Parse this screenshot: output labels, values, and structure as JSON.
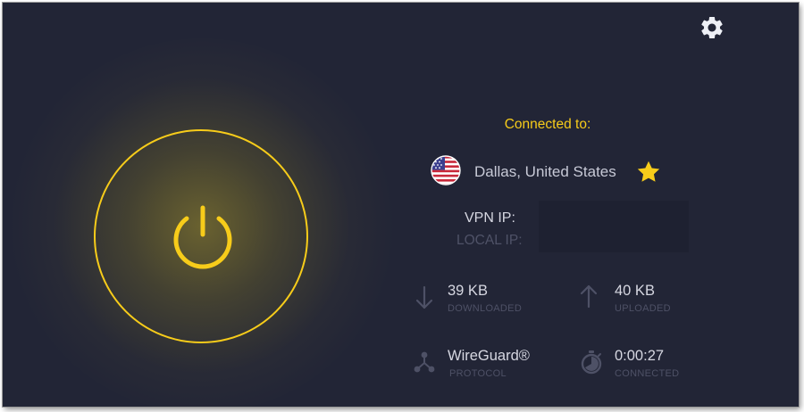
{
  "header": {
    "settings_icon": "gear-icon"
  },
  "power": {
    "state": "connected",
    "icon": "power-icon",
    "color": "#f7cc1a"
  },
  "connection": {
    "heading": "Connected to:",
    "flag_icon": "us-flag-icon",
    "location": "Dallas, United States",
    "favorite_icon": "star-icon",
    "favorite": true
  },
  "ip": {
    "vpn_label": "VPN IP:",
    "local_label": "LOCAL IP:"
  },
  "stats": {
    "downloaded": {
      "value": "39 KB",
      "label": "DOWNLOADED",
      "icon": "arrow-down-icon"
    },
    "uploaded": {
      "value": "40 KB",
      "label": "UPLOADED",
      "icon": "arrow-up-icon"
    },
    "protocol": {
      "value": "WireGuard®",
      "label": "PROTOCOL",
      "icon": "network-icon"
    },
    "duration": {
      "value": "0:00:27",
      "label": "CONNECTED",
      "icon": "stopwatch-icon"
    }
  },
  "colors": {
    "accent": "#f7cc1a",
    "background": "#222536",
    "text": "#d6d7e1",
    "muted": "#4e5166"
  }
}
